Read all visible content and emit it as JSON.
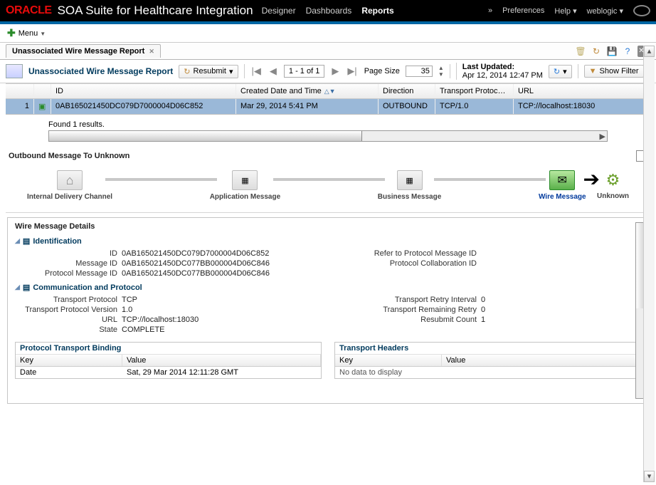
{
  "header": {
    "brand": "ORACLE",
    "suite": "SOA Suite for Healthcare Integration",
    "nav": [
      "Designer",
      "Dashboards",
      "Reports"
    ],
    "active_nav": "Reports",
    "preferences": "Preferences",
    "help": "Help",
    "user": "weblogic"
  },
  "menubar": {
    "menu": "Menu"
  },
  "tab": {
    "label": "Unassociated Wire Message Report"
  },
  "toolbar": {
    "title": "Unassociated Wire Message Report",
    "resubmit": "Resubmit",
    "pager": "1 - 1 of 1",
    "page_size_label": "Page Size",
    "page_size": "35",
    "last_updated_label": "Last Updated:",
    "last_updated_value": "Apr 12, 2014 12:47 PM",
    "show_filter": "Show Filter"
  },
  "grid": {
    "columns": [
      "ID",
      "Created Date and Time",
      "Direction",
      "Transport Protocol/Version",
      "URL"
    ],
    "row": {
      "num": "1",
      "id": "0AB165021450DC079D7000004D06C852",
      "created": "Mar 29, 2014 5:41 PM",
      "direction": "OUTBOUND",
      "transport": "TCP/1.0",
      "url": "TCP://localhost:18030"
    },
    "found": "Found 1 results."
  },
  "flow": {
    "title": "Outbound Message To Unknown",
    "nodes": [
      "Internal Delivery Channel",
      "Application Message",
      "Business Message",
      "Wire Message",
      "Unknown"
    ]
  },
  "details": {
    "title": "Wire Message Details",
    "identification": {
      "heading": "Identification",
      "rows_left": [
        {
          "k": "ID",
          "v": "0AB165021450DC079D7000004D06C852"
        },
        {
          "k": "Message ID",
          "v": "0AB165021450DC077BB000004D06C846"
        },
        {
          "k": "Protocol Message ID",
          "v": "0AB165021450DC077BB000004D06C846"
        }
      ],
      "rows_right": [
        {
          "k": "Refer to Protocol Message ID",
          "v": ""
        },
        {
          "k": "Protocol Collaboration ID",
          "v": ""
        }
      ]
    },
    "comm": {
      "heading": "Communication and Protocol",
      "rows_left": [
        {
          "k": "Transport Protocol",
          "v": "TCP"
        },
        {
          "k": "Transport Protocol Version",
          "v": "1.0"
        },
        {
          "k": "URL",
          "v": "TCP://localhost:18030"
        },
        {
          "k": "State",
          "v": "COMPLETE"
        }
      ],
      "rows_right": [
        {
          "k": "Transport Retry Interval",
          "v": "0"
        },
        {
          "k": "Transport Remaining Retry",
          "v": "0"
        },
        {
          "k": "Resubmit Count",
          "v": "1"
        }
      ]
    },
    "ptb": {
      "heading": "Protocol Transport Binding",
      "cols": [
        "Key",
        "Value"
      ],
      "row": {
        "k": "Date",
        "v": "Sat, 29 Mar 2014 12:11:28 GMT"
      }
    },
    "th": {
      "heading": "Transport Headers",
      "cols": [
        "Key",
        "Value"
      ],
      "empty": "No data to display"
    }
  }
}
